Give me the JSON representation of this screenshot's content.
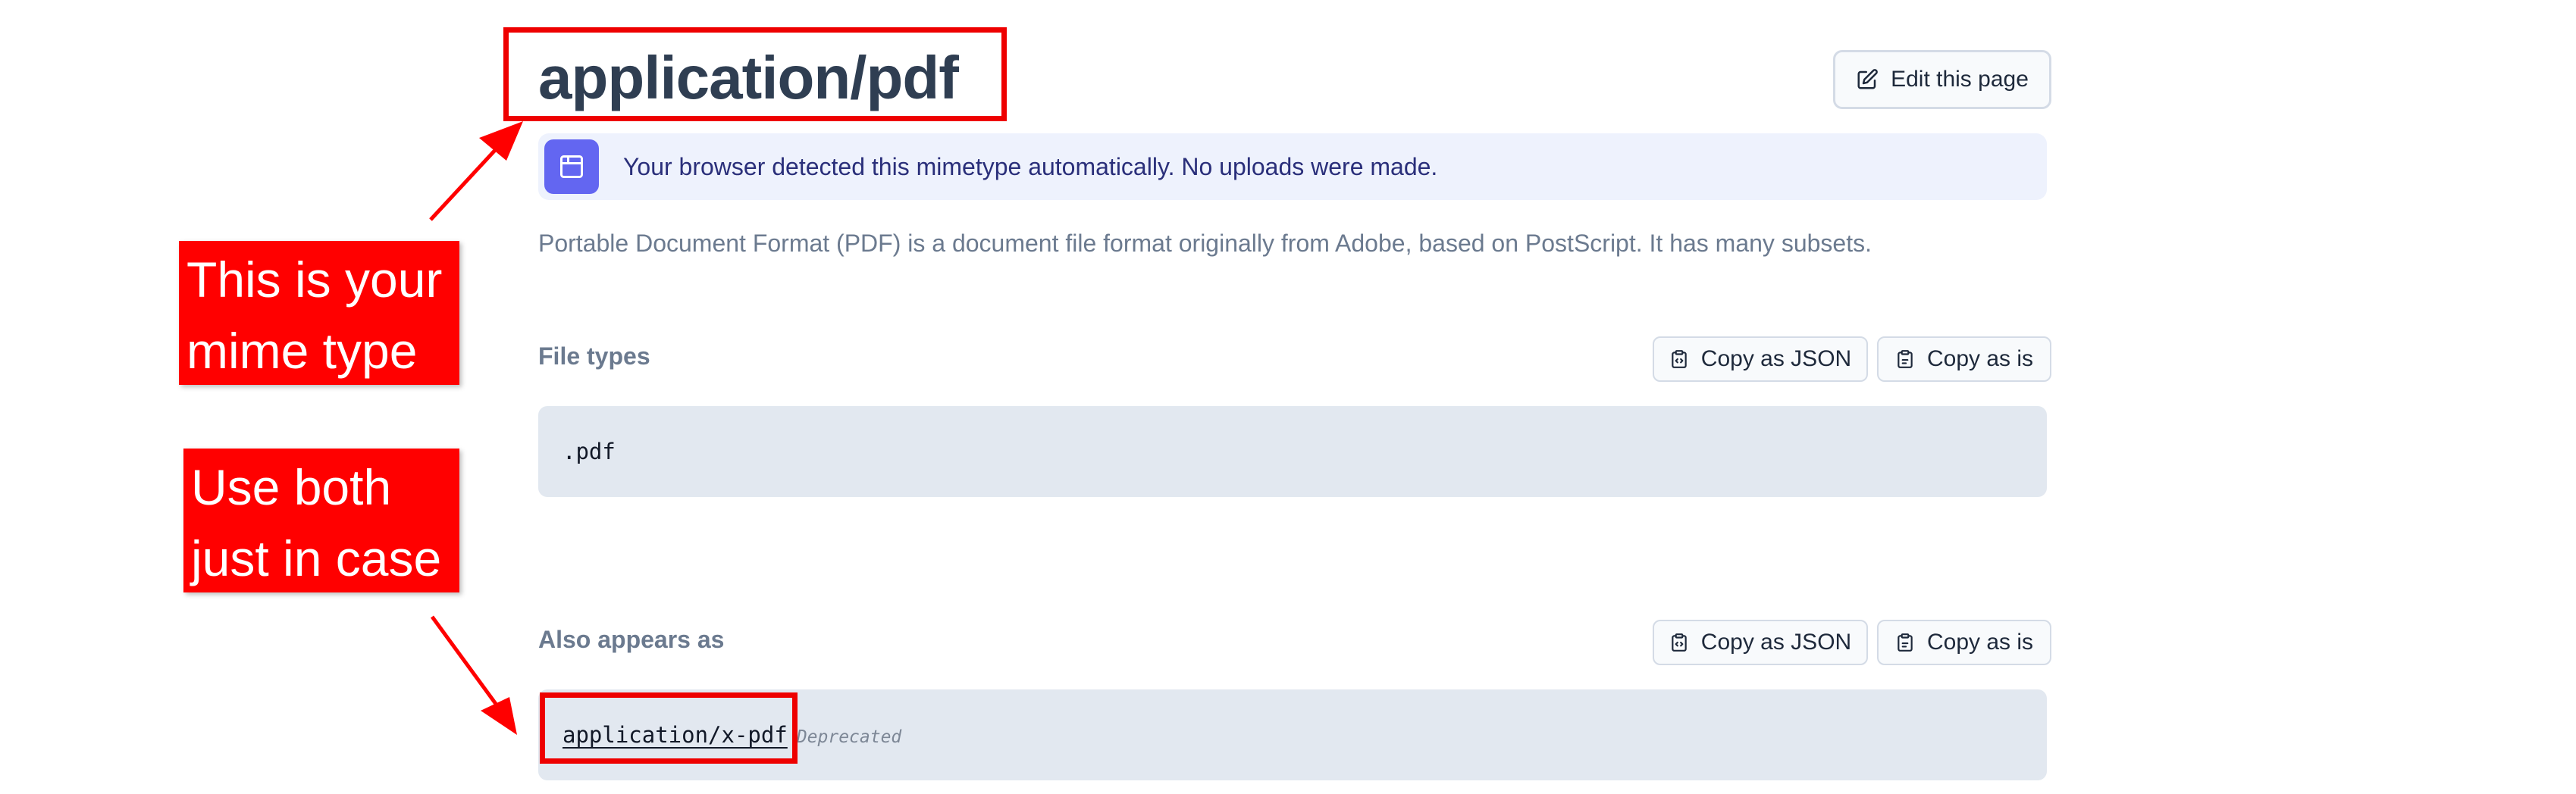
{
  "page": {
    "title": "application/pdf",
    "edit_button_label": "Edit this page"
  },
  "banner": {
    "text": "Your browser detected this mimetype automatically. No uploads were made.",
    "icon": "browser-window-icon"
  },
  "description": "Portable Document Format (PDF) is a document file format originally from Adobe, based on PostScript. It has many subsets.",
  "file_types": {
    "heading": "File types",
    "copy_json_label": "Copy as JSON",
    "copy_as_is_label": "Copy as is",
    "values": [
      ".pdf"
    ]
  },
  "also_appears_as": {
    "heading": "Also appears as",
    "copy_json_label": "Copy as JSON",
    "copy_as_is_label": "Copy as is",
    "items": [
      {
        "mimetype": "application/x-pdf",
        "badge": "Deprecated"
      }
    ]
  },
  "annotations": {
    "note_1": [
      "This is your",
      "mime type"
    ],
    "note_2": [
      "Use both",
      "just in case"
    ],
    "color": "#ff0000"
  },
  "colors": {
    "title": "#2f3e52",
    "banner_bg": "#eef2fd",
    "banner_icon_bg": "#6366f1",
    "code_bg": "#e2e8f0",
    "muted_text": "#6b7a8f"
  }
}
